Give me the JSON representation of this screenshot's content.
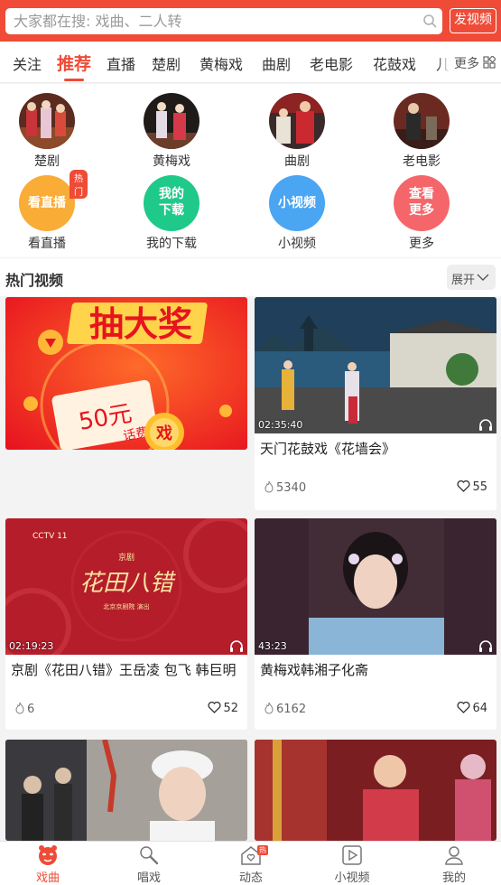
{
  "search": {
    "placeholder": "大家都在搜: 戏曲、二人转",
    "publish_label": "发视频"
  },
  "tabs": [
    {
      "label": "关注",
      "active": false
    },
    {
      "label": "推荐",
      "active": true
    },
    {
      "label": "直播",
      "active": false
    },
    {
      "label": "楚剧",
      "active": false
    },
    {
      "label": "黄梅戏",
      "active": false
    },
    {
      "label": "曲剧",
      "active": false
    },
    {
      "label": "老电影",
      "active": false
    },
    {
      "label": "花鼓戏",
      "active": false
    },
    {
      "label": "儿",
      "active": false
    }
  ],
  "more_label": "更多",
  "quick_entries": {
    "row1": [
      {
        "label": "楚剧"
      },
      {
        "label": "黄梅戏"
      },
      {
        "label": "曲剧"
      },
      {
        "label": "老电影"
      }
    ],
    "row2": [
      {
        "label": "看直播",
        "icon_text": "看直播",
        "color": "#f9ac36",
        "badge": "热门"
      },
      {
        "label": "我的下载",
        "icon_text_1": "我的",
        "icon_text_2": "下载",
        "color": "#1fc98a"
      },
      {
        "label": "小视频",
        "icon_text": "小视频",
        "color": "#4aa5f3"
      },
      {
        "label": "更多",
        "icon_text_1": "查看",
        "icon_text_2": "更多",
        "color": "#f4666a"
      }
    ]
  },
  "section": {
    "title": "热门视频",
    "expand_label": "展开"
  },
  "ad_banner": {
    "headline": "抽大奖",
    "coupon": "50元",
    "coupon_sub": "话费",
    "coin_text": "戏"
  },
  "videos": [
    {
      "title": "天门花鼓戏《花墙会》",
      "duration": "02:35:40",
      "views": "5340",
      "likes": "55"
    },
    {
      "title": "京剧《花田八错》王岳凌 包飞 韩巨明",
      "duration": "02:19:23",
      "views": "6",
      "likes": "52",
      "thumb_text": "花田八错",
      "thumb_small": "京剧",
      "thumb_sub": "北京京剧院 演出",
      "channel_logo": "CCTV 11"
    },
    {
      "title": "黄梅戏韩湘子化斋",
      "duration": "43:23",
      "views": "6162",
      "likes": "64"
    },
    {
      "title": "",
      "duration": "",
      "views": "",
      "likes": ""
    },
    {
      "title": "",
      "duration": "",
      "views": "",
      "likes": ""
    }
  ],
  "bottom_nav": [
    {
      "label": "戏曲",
      "icon": "opera-mask-icon",
      "active": true
    },
    {
      "label": "唱戏",
      "icon": "microphone-icon",
      "active": false
    },
    {
      "label": "动态",
      "icon": "home-heart-icon",
      "active": false,
      "badge": "热"
    },
    {
      "label": "小视频",
      "icon": "play-square-icon",
      "active": false
    },
    {
      "label": "我的",
      "icon": "user-icon",
      "active": false
    }
  ],
  "colors": {
    "accent": "#ef4b37"
  }
}
